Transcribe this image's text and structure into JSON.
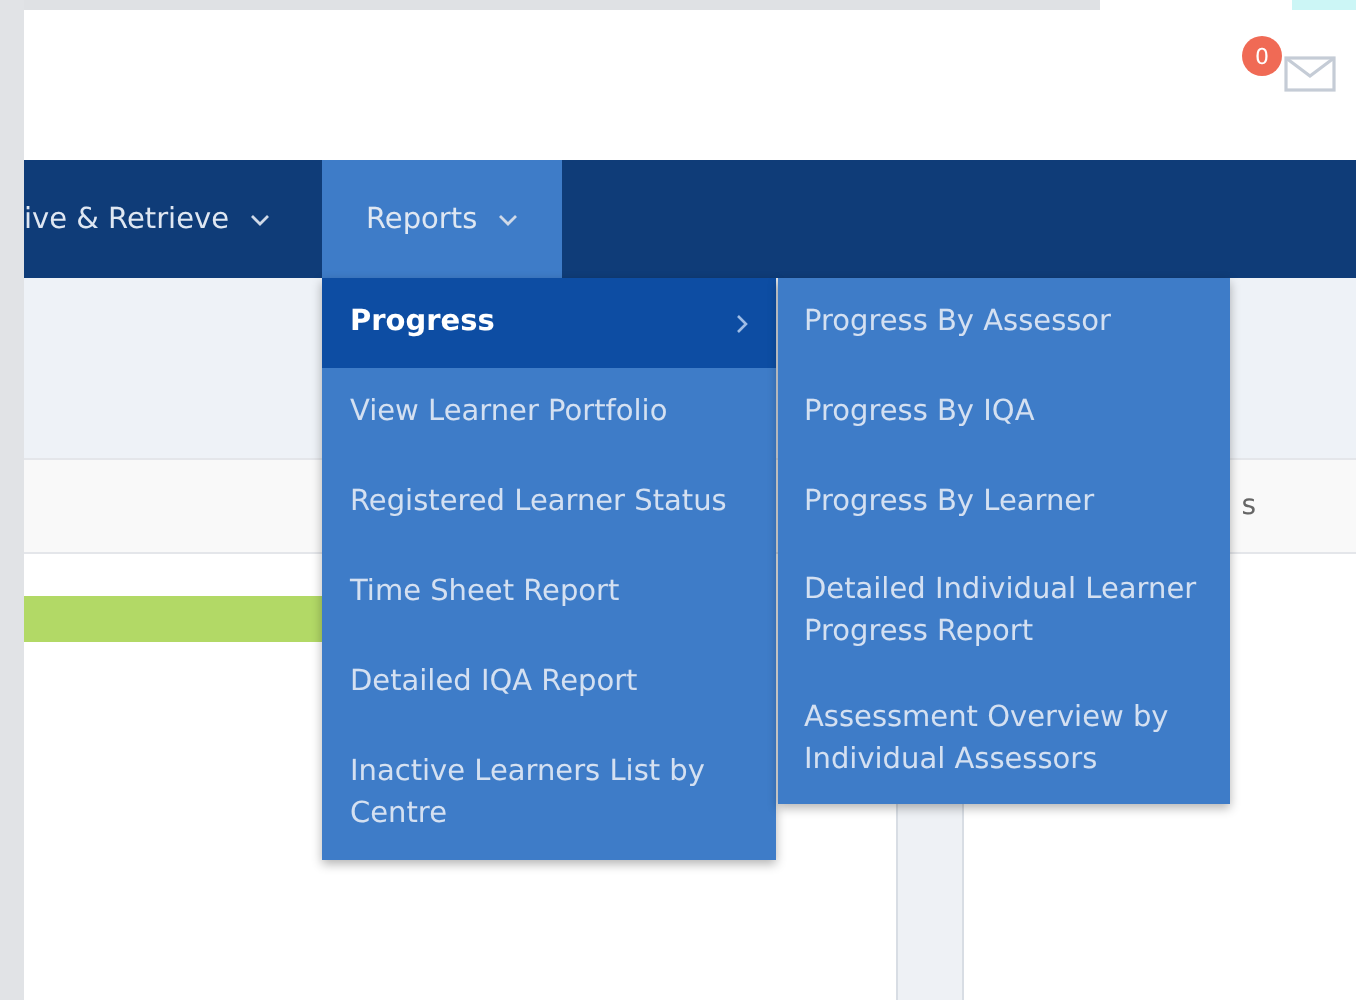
{
  "header": {
    "notification_count": "0"
  },
  "nav": {
    "items": [
      {
        "label": "ive & Retrieve",
        "selected": false
      },
      {
        "label": "Reports",
        "selected": true
      }
    ]
  },
  "table_header": {
    "column_partial": "s"
  },
  "reports_menu": {
    "items": [
      {
        "label": "Progress",
        "selected": true,
        "has_submenu": true
      },
      {
        "label": "View Learner Portfolio",
        "selected": false,
        "has_submenu": false
      },
      {
        "label": "Registered Learner Status",
        "selected": false,
        "has_submenu": false
      },
      {
        "label": "Time Sheet Report",
        "selected": false,
        "has_submenu": false
      },
      {
        "label": "Detailed IQA Report",
        "selected": false,
        "has_submenu": false
      },
      {
        "label": "Inactive Learners List by Centre",
        "selected": false,
        "has_submenu": false
      }
    ]
  },
  "progress_submenu": {
    "items": [
      {
        "label": "Progress By Assessor",
        "selected": false
      },
      {
        "label": "Progress By IQA",
        "selected": false
      },
      {
        "label": "Progress By Learner",
        "selected": false
      },
      {
        "label": "Detailed Individual Learner Progress Report",
        "selected": false
      },
      {
        "label": "Assessment Overview by Individual Assessors",
        "selected": false
      }
    ]
  }
}
